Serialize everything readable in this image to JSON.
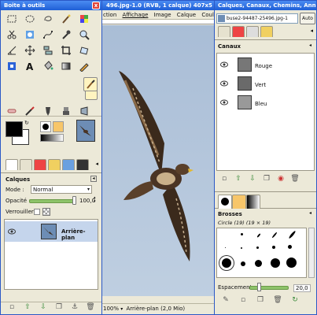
{
  "toolbox": {
    "title": "Boite à outils",
    "close": "x"
  },
  "layers": {
    "title": "Calques",
    "mode_label": "Mode :",
    "mode_value": "Normal",
    "opacity_label": "Opacité :",
    "opacity_value": "100,0",
    "lock_label": "Verrouiller :",
    "layer_name": "Arrière-plan"
  },
  "image_window": {
    "title": "496.jpg-1.0 (RVB, 1 calque) 407x5",
    "menus": [
      "ction",
      "Affichage",
      "Image",
      "Calque",
      "Couleu"
    ],
    "zoom": "100%",
    "status": "Arrière-plan (2,0 Mio)"
  },
  "dock": {
    "title": "Calques, Canaux, Chemins, Ann...",
    "image_select": "buse2-94487-25496.jpg-1",
    "auto_label": "Auto",
    "canaux_title": "Canaux",
    "channels": [
      "Rouge",
      "Vert",
      "Bleu"
    ],
    "brosses_title": "Brosses",
    "brush_desc": "Circle (19) (19 × 19)",
    "spacing_label": "Espacement :",
    "spacing_value": "20,0"
  },
  "colors": {
    "titlebar": "#2b63d8",
    "accent": "#f7c66a",
    "canvas_bg": "#b6c7db"
  }
}
